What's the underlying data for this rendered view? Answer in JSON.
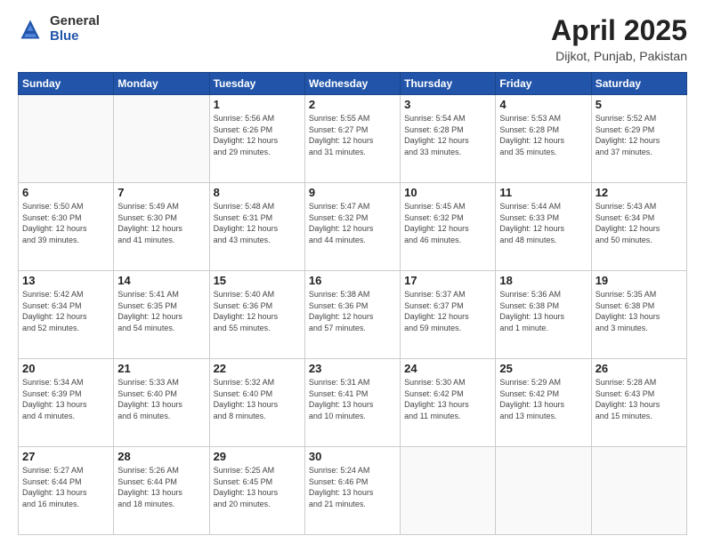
{
  "logo": {
    "general": "General",
    "blue": "Blue"
  },
  "title": "April 2025",
  "subtitle": "Dijkot, Punjab, Pakistan",
  "days_header": [
    "Sunday",
    "Monday",
    "Tuesday",
    "Wednesday",
    "Thursday",
    "Friday",
    "Saturday"
  ],
  "weeks": [
    [
      {
        "day": "",
        "info": ""
      },
      {
        "day": "",
        "info": ""
      },
      {
        "day": "1",
        "info": "Sunrise: 5:56 AM\nSunset: 6:26 PM\nDaylight: 12 hours\nand 29 minutes."
      },
      {
        "day": "2",
        "info": "Sunrise: 5:55 AM\nSunset: 6:27 PM\nDaylight: 12 hours\nand 31 minutes."
      },
      {
        "day": "3",
        "info": "Sunrise: 5:54 AM\nSunset: 6:28 PM\nDaylight: 12 hours\nand 33 minutes."
      },
      {
        "day": "4",
        "info": "Sunrise: 5:53 AM\nSunset: 6:28 PM\nDaylight: 12 hours\nand 35 minutes."
      },
      {
        "day": "5",
        "info": "Sunrise: 5:52 AM\nSunset: 6:29 PM\nDaylight: 12 hours\nand 37 minutes."
      }
    ],
    [
      {
        "day": "6",
        "info": "Sunrise: 5:50 AM\nSunset: 6:30 PM\nDaylight: 12 hours\nand 39 minutes."
      },
      {
        "day": "7",
        "info": "Sunrise: 5:49 AM\nSunset: 6:30 PM\nDaylight: 12 hours\nand 41 minutes."
      },
      {
        "day": "8",
        "info": "Sunrise: 5:48 AM\nSunset: 6:31 PM\nDaylight: 12 hours\nand 43 minutes."
      },
      {
        "day": "9",
        "info": "Sunrise: 5:47 AM\nSunset: 6:32 PM\nDaylight: 12 hours\nand 44 minutes."
      },
      {
        "day": "10",
        "info": "Sunrise: 5:45 AM\nSunset: 6:32 PM\nDaylight: 12 hours\nand 46 minutes."
      },
      {
        "day": "11",
        "info": "Sunrise: 5:44 AM\nSunset: 6:33 PM\nDaylight: 12 hours\nand 48 minutes."
      },
      {
        "day": "12",
        "info": "Sunrise: 5:43 AM\nSunset: 6:34 PM\nDaylight: 12 hours\nand 50 minutes."
      }
    ],
    [
      {
        "day": "13",
        "info": "Sunrise: 5:42 AM\nSunset: 6:34 PM\nDaylight: 12 hours\nand 52 minutes."
      },
      {
        "day": "14",
        "info": "Sunrise: 5:41 AM\nSunset: 6:35 PM\nDaylight: 12 hours\nand 54 minutes."
      },
      {
        "day": "15",
        "info": "Sunrise: 5:40 AM\nSunset: 6:36 PM\nDaylight: 12 hours\nand 55 minutes."
      },
      {
        "day": "16",
        "info": "Sunrise: 5:38 AM\nSunset: 6:36 PM\nDaylight: 12 hours\nand 57 minutes."
      },
      {
        "day": "17",
        "info": "Sunrise: 5:37 AM\nSunset: 6:37 PM\nDaylight: 12 hours\nand 59 minutes."
      },
      {
        "day": "18",
        "info": "Sunrise: 5:36 AM\nSunset: 6:38 PM\nDaylight: 13 hours\nand 1 minute."
      },
      {
        "day": "19",
        "info": "Sunrise: 5:35 AM\nSunset: 6:38 PM\nDaylight: 13 hours\nand 3 minutes."
      }
    ],
    [
      {
        "day": "20",
        "info": "Sunrise: 5:34 AM\nSunset: 6:39 PM\nDaylight: 13 hours\nand 4 minutes."
      },
      {
        "day": "21",
        "info": "Sunrise: 5:33 AM\nSunset: 6:40 PM\nDaylight: 13 hours\nand 6 minutes."
      },
      {
        "day": "22",
        "info": "Sunrise: 5:32 AM\nSunset: 6:40 PM\nDaylight: 13 hours\nand 8 minutes."
      },
      {
        "day": "23",
        "info": "Sunrise: 5:31 AM\nSunset: 6:41 PM\nDaylight: 13 hours\nand 10 minutes."
      },
      {
        "day": "24",
        "info": "Sunrise: 5:30 AM\nSunset: 6:42 PM\nDaylight: 13 hours\nand 11 minutes."
      },
      {
        "day": "25",
        "info": "Sunrise: 5:29 AM\nSunset: 6:42 PM\nDaylight: 13 hours\nand 13 minutes."
      },
      {
        "day": "26",
        "info": "Sunrise: 5:28 AM\nSunset: 6:43 PM\nDaylight: 13 hours\nand 15 minutes."
      }
    ],
    [
      {
        "day": "27",
        "info": "Sunrise: 5:27 AM\nSunset: 6:44 PM\nDaylight: 13 hours\nand 16 minutes."
      },
      {
        "day": "28",
        "info": "Sunrise: 5:26 AM\nSunset: 6:44 PM\nDaylight: 13 hours\nand 18 minutes."
      },
      {
        "day": "29",
        "info": "Sunrise: 5:25 AM\nSunset: 6:45 PM\nDaylight: 13 hours\nand 20 minutes."
      },
      {
        "day": "30",
        "info": "Sunrise: 5:24 AM\nSunset: 6:46 PM\nDaylight: 13 hours\nand 21 minutes."
      },
      {
        "day": "",
        "info": ""
      },
      {
        "day": "",
        "info": ""
      },
      {
        "day": "",
        "info": ""
      }
    ]
  ]
}
